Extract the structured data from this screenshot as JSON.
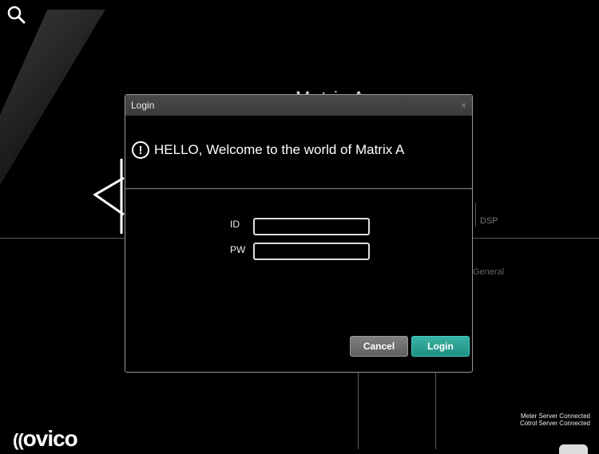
{
  "background": {
    "title": "Matrix A",
    "tabs": {
      "dsp": "DSP",
      "general": "General"
    },
    "status": {
      "meter": "Meter Server Connected",
      "control": "Cotrol Server Connected"
    },
    "logo_text": "ovico"
  },
  "modal": {
    "title": "Login",
    "close": "×",
    "welcome_icon": "!",
    "welcome": "HELLO, Welcome to the world of Matrix A",
    "id_label": "ID",
    "pw_label": "PW",
    "id_value": "",
    "pw_value": "",
    "cancel_label": "Cancel",
    "login_label": "Login"
  },
  "colors": {
    "accent": "#26a193",
    "cancel": "#6b6b6b"
  }
}
